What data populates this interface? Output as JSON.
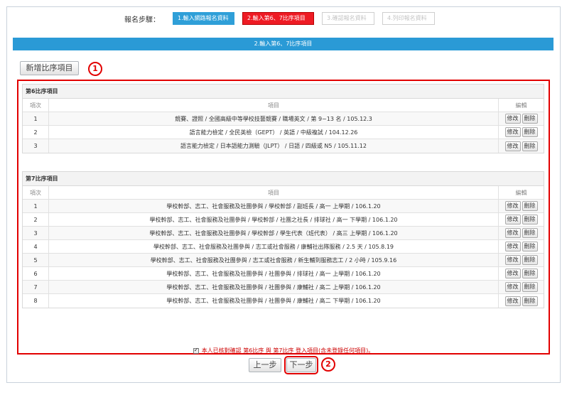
{
  "steps": {
    "label": "報名步驟：",
    "items": [
      "1.輸入網路報名資料",
      "2.輸入第6、7比序項目",
      "3.確認報名資料",
      "4.列印報名資料"
    ]
  },
  "section_bar": "2.輸入第6、7比序項目",
  "add_button": "新增比序項目",
  "markers": [
    "1",
    "2"
  ],
  "columns": {
    "num": "項次",
    "item": "項目",
    "edit": "編輯"
  },
  "row_buttons": {
    "modify": "修改",
    "delete": "刪除"
  },
  "section6": {
    "title": "第6比序項目",
    "rows": [
      {
        "num": "1",
        "item": "競賽、證照 / 全國高級中等學校技藝競賽 / 職場英文 / 第 9~13 名 / 105.12.3"
      },
      {
        "num": "2",
        "item": "語言能力檢定 / 全民英檢（GEPT） / 英語 / 中級複試 / 104.12.26"
      },
      {
        "num": "3",
        "item": "語言能力檢定 / 日本語能力測驗（JLPT） / 日語 / 四級或 N5 / 105.11.12"
      }
    ]
  },
  "section7": {
    "title": "第7比序項目",
    "rows": [
      {
        "num": "1",
        "item": "學校幹部、志工、社會服務及社團參與 / 學校幹部 / 副班長 / 高一 上學期 / 106.1.20"
      },
      {
        "num": "2",
        "item": "學校幹部、志工、社會服務及社團參與 / 學校幹部 / 社團之社長 / 排球社 / 高一 下學期 / 106.1.20"
      },
      {
        "num": "3",
        "item": "學校幹部、志工、社會服務及社團參與 / 學校幹部 / 學生代表（班代表） / 高三 上學期 / 106.1.20"
      },
      {
        "num": "4",
        "item": "學校幹部、志工、社會服務及社團參與 / 志工或社會服務 / 康輔社出隊服務 / 2.5 天 / 105.8.19"
      },
      {
        "num": "5",
        "item": "學校幹部、志工、社會服務及社團參與 / 志工或社會服務 / 新生輔到服務志工 / 2 小時 / 105.9.16"
      },
      {
        "num": "6",
        "item": "學校幹部、志工、社會服務及社團參與 / 社團參與 / 排球社 / 高一 上學期 / 106.1.20"
      },
      {
        "num": "7",
        "item": "學校幹部、志工、社會服務及社團參與 / 社團參與 / 康輔社 / 高二 上學期 / 106.1.20"
      },
      {
        "num": "8",
        "item": "學校幹部、志工、社會服務及社團參與 / 社團參與 / 康輔社 / 高二 下學期 / 106.1.20"
      }
    ]
  },
  "confirm": {
    "prefix": "本人已核對確認 ",
    "sec6": "第6比序",
    "mid": " 與 ",
    "sec7": "第7比序",
    "suffix": " 登入項目(含未登錄任何項目)。"
  },
  "nav": {
    "prev": "上一步",
    "next": "下一步"
  }
}
